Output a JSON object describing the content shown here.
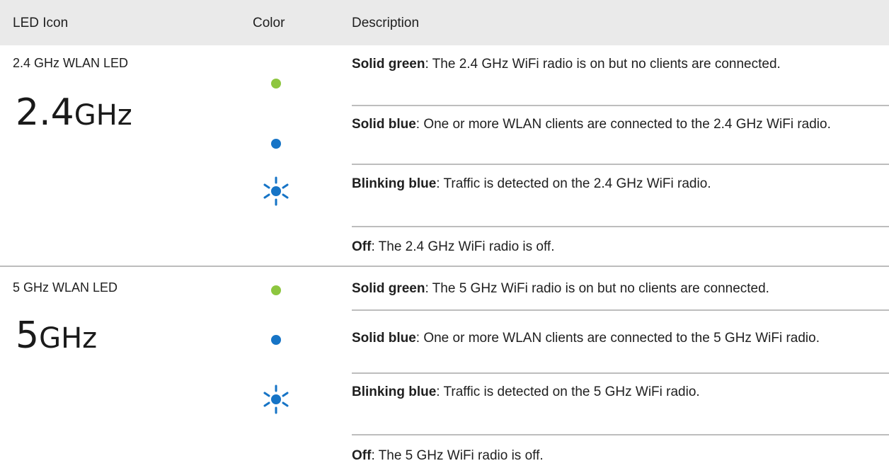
{
  "headers": {
    "icon": "LED Icon",
    "color": "Color",
    "description": "Description"
  },
  "colors": {
    "green": "#8dc63f",
    "blue": "#1674c6",
    "header_bg": "#eaeaea",
    "rule": "#bdbdbd"
  },
  "groups": [
    {
      "name": "2.4 GHz WLAN LED",
      "icon_number": "2.4",
      "icon_unit": "GHz",
      "rows": [
        {
          "color_indicator": "green-dot",
          "state": "Solid green",
          "text": ": The 2.4 GHz WiFi radio is on but no clients are connected."
        },
        {
          "color_indicator": "blue-dot",
          "state": "Solid blue",
          "text": ": One or more WLAN clients are connected to the 2.4 GHz WiFi radio."
        },
        {
          "color_indicator": "blinking-blue-icon",
          "state": "Blinking blue",
          "text": ": Traffic is detected on the 2.4 GHz WiFi radio."
        },
        {
          "color_indicator": "none",
          "state": "Off",
          "text": ": The 2.4 GHz WiFi radio is off."
        }
      ]
    },
    {
      "name": "5 GHz WLAN LED",
      "icon_number": "5",
      "icon_unit": "GHz",
      "rows": [
        {
          "color_indicator": "green-dot",
          "state": "Solid green",
          "text": ": The 5 GHz WiFi radio is on but no clients are connected."
        },
        {
          "color_indicator": "blue-dot",
          "state": "Solid blue",
          "text": ": One or more WLAN clients are connected to the 5 GHz WiFi radio."
        },
        {
          "color_indicator": "blinking-blue-icon",
          "state": "Blinking blue",
          "text": ": Traffic is detected on the 5 GHz WiFi radio."
        },
        {
          "color_indicator": "none",
          "state": "Off",
          "text": ": The 5 GHz WiFi radio is off."
        }
      ]
    }
  ]
}
